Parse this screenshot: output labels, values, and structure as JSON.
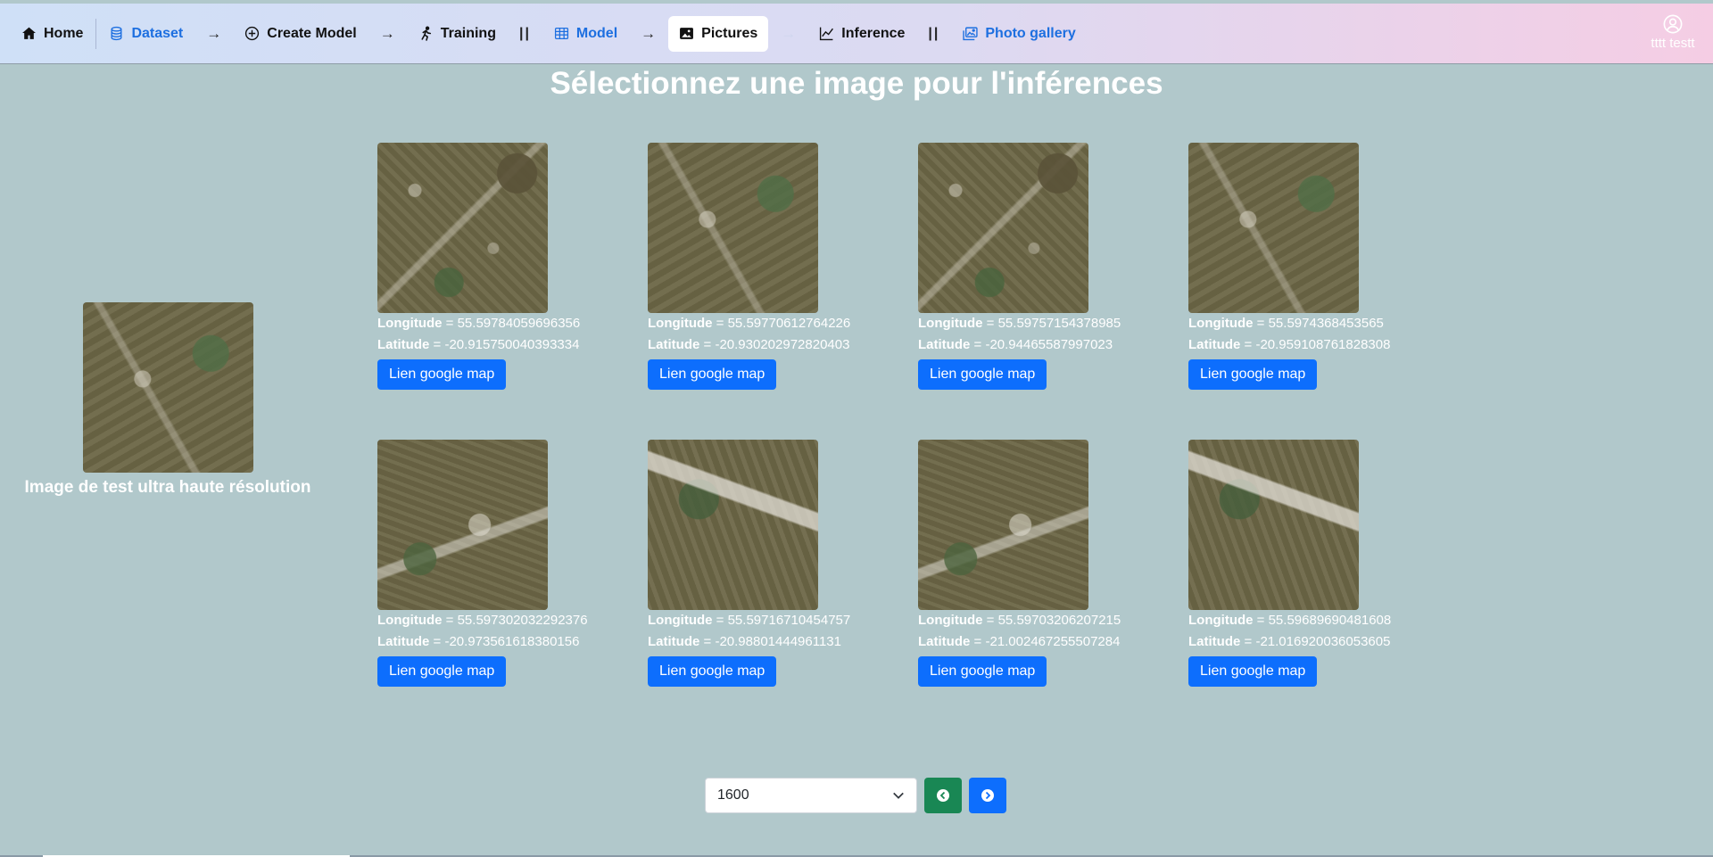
{
  "nav": {
    "home": "Home",
    "dataset": "Dataset",
    "create_model": "Create Model",
    "training": "Training",
    "model": "Model",
    "pictures": "Pictures",
    "inference": "Inference",
    "photo_gallery": "Photo gallery",
    "arrow": "→",
    "bars": "||"
  },
  "user": {
    "name": "tttt testt"
  },
  "page": {
    "title": "Sélectionnez une image pour l'inférences"
  },
  "test_image": {
    "caption": "Image de test ultra haute résolution"
  },
  "labels": {
    "longitude": "Longitude",
    "latitude": "Latitude",
    "equals": " = ",
    "map_button": "Lien google map"
  },
  "images": [
    {
      "longitude": "55.59784059696356",
      "latitude": "-20.915750040393334"
    },
    {
      "longitude": "55.59770612764226",
      "latitude": "-20.930202972820403"
    },
    {
      "longitude": "55.59757154378985",
      "latitude": "-20.94465587997023"
    },
    {
      "longitude": "55.5974368453565",
      "latitude": "-20.959108761828308"
    },
    {
      "longitude": "55.597302032292376",
      "latitude": "-20.973561618380156"
    },
    {
      "longitude": "55.59716710454757",
      "latitude": "-20.98801444961131"
    },
    {
      "longitude": "55.59703206207215",
      "latitude": "-21.002467255507284"
    },
    {
      "longitude": "55.59689690481608",
      "latitude": "-21.016920036053605"
    }
  ],
  "pagination": {
    "selected": "1600"
  },
  "colors": {
    "background": "#b1c8cb",
    "primary": "#0d6efd",
    "success": "#198754",
    "nav_accent": "#1d6fe0"
  }
}
